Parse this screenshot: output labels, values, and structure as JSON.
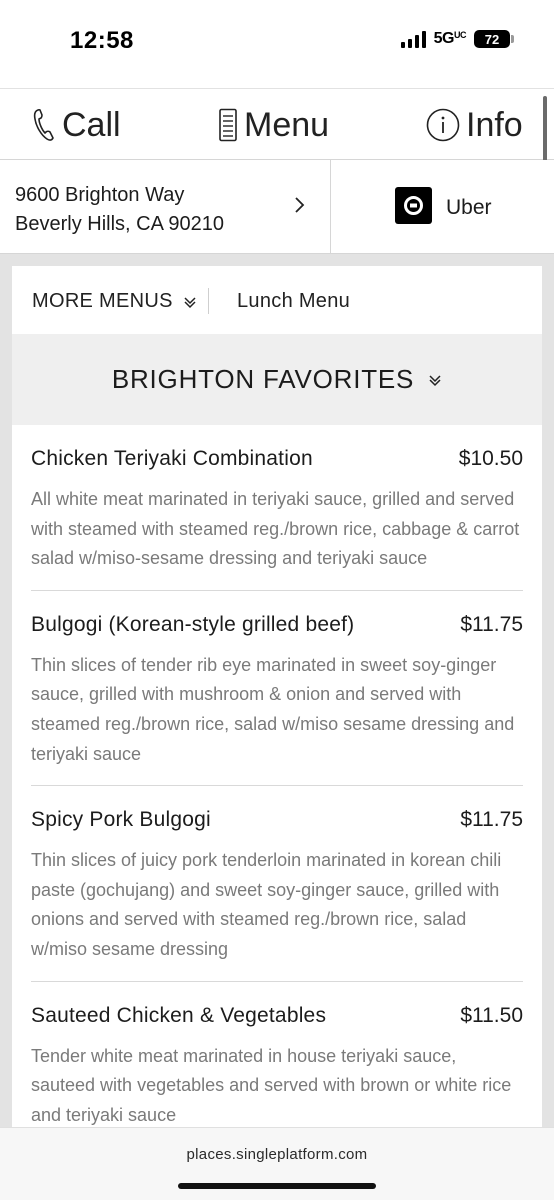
{
  "status_bar": {
    "time": "12:58",
    "network": "5G",
    "network_suffix": "UC",
    "battery": "72"
  },
  "nav": {
    "call_label": "Call",
    "menu_label": "Menu",
    "info_label": "Info",
    "icons": [
      "phone-icon",
      "menu-card-icon",
      "info-icon"
    ]
  },
  "location": {
    "address_line1": "9600 Brighton Way",
    "address_line2": "Beverly Hills, CA 90210",
    "uber_label": "Uber"
  },
  "menus": {
    "more_menus_label": "MORE MENUS",
    "current_menu": "Lunch Menu",
    "section_title": "BRIGHTON FAVORITES"
  },
  "items": [
    {
      "name": "Chicken Teriyaki Combination",
      "price": "$10.50",
      "description": "All white meat marinated in teriyaki sauce, grilled and served with steamed with steamed reg./brown rice, cabbage & carrot salad w/miso-sesame dressing and teriyaki sauce"
    },
    {
      "name": "Bulgogi (Korean-style grilled beef)",
      "price": "$11.75",
      "description": "Thin slices of tender rib eye marinated in sweet soy-ginger sauce, grilled with mushroom & onion and served with steamed reg./brown rice, salad w/miso sesame dressing and teriyaki sauce"
    },
    {
      "name": "Spicy Pork Bulgogi",
      "price": "$11.75",
      "description": "Thin slices of juicy pork tenderloin marinated in korean chili paste (gochujang) and sweet soy-ginger sauce, grilled with onions and served with steamed reg./brown rice, salad w/miso sesame dressing"
    },
    {
      "name": "Sauteed Chicken & Vegetables",
      "price": "$11.50",
      "description": "Tender white meat marinated in house teriyaki sauce, sauteed with vegetables and served with brown or white rice and teriyaki sauce"
    }
  ],
  "browser": {
    "url": "places.singleplatform.com"
  },
  "colors": {
    "text": "#1c1c1c",
    "description_text": "#7a7a7a",
    "panel_background": "#e3e3e3",
    "section_header_background": "#efefef"
  }
}
